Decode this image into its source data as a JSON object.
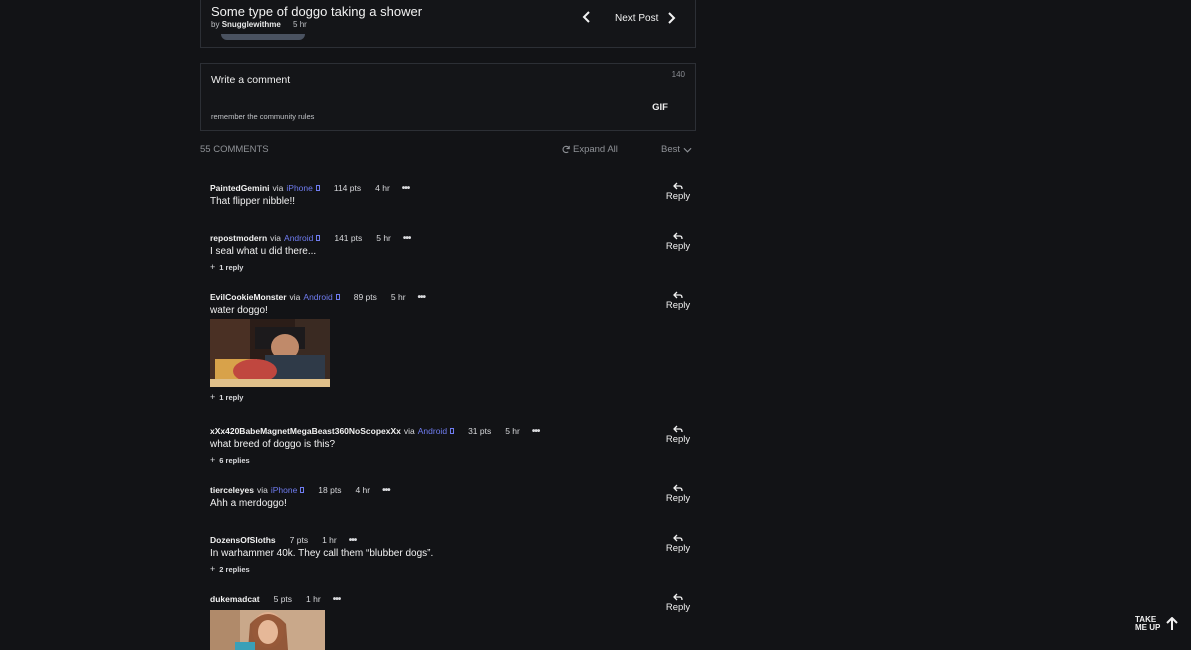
{
  "post": {
    "title": "Some type of doggo taking a shower",
    "by": "by",
    "author": "Snugglewithme",
    "time": "5 hr",
    "next_label": "Next Post"
  },
  "comment_box": {
    "placeholder": "Write a comment",
    "char_count": "140",
    "gif_label": "GIF",
    "rules_text": "remember the community rules"
  },
  "bar": {
    "count_label": "55 COMMENTS",
    "expand_label": "Expand All",
    "sort_label": "Best"
  },
  "via_label": "via",
  "reply_label": "Reply",
  "take_me_up": {
    "line1": "TAKE",
    "line2": "ME UP"
  },
  "comments": [
    {
      "user": "PaintedGemini",
      "device": "iPhone",
      "points": "114 pts",
      "time": "4 hr",
      "text": "That flipper nibble!!",
      "replies": ""
    },
    {
      "user": "repostmodern",
      "device": "Android",
      "points": "141 pts",
      "time": "5 hr",
      "text": "I seal what u did there...",
      "replies": "1 reply"
    },
    {
      "user": "EvilCookieMonster",
      "device": "Android",
      "points": "89 pts",
      "time": "5 hr",
      "text": "water doggo!",
      "replies": "1 reply",
      "has_image": true
    },
    {
      "user": "xXx420BabeMagnetMegaBeast360NoScopexXx",
      "device": "Android",
      "points": "31 pts",
      "time": "5 hr",
      "text": "what breed of doggo is this?",
      "replies": "6 replies"
    },
    {
      "user": "tierceleyes",
      "device": "iPhone",
      "points": "18 pts",
      "time": "4 hr",
      "text": "Ahh a merdoggo!",
      "replies": ""
    },
    {
      "user": "DozensOfSloths",
      "device": "",
      "points": "7 pts",
      "time": "1 hr",
      "text": "In warhammer 40k. They call them “blubber dogs”.",
      "replies": "2 replies"
    },
    {
      "user": "dukemadcat",
      "device": "",
      "points": "5 pts",
      "time": "1 hr",
      "text": "",
      "replies": "",
      "has_image": true
    }
  ],
  "colors": {
    "background": "#121316",
    "device_link": "#6f7cf0",
    "border": "#2c2f35"
  },
  "icons": [
    "chevron-left-icon",
    "chevron-right-icon",
    "refresh-icon",
    "chevron-down-icon",
    "reply-arrow-icon",
    "more-dots-icon",
    "arrow-up-icon",
    "plus-icon",
    "device-icon"
  ]
}
